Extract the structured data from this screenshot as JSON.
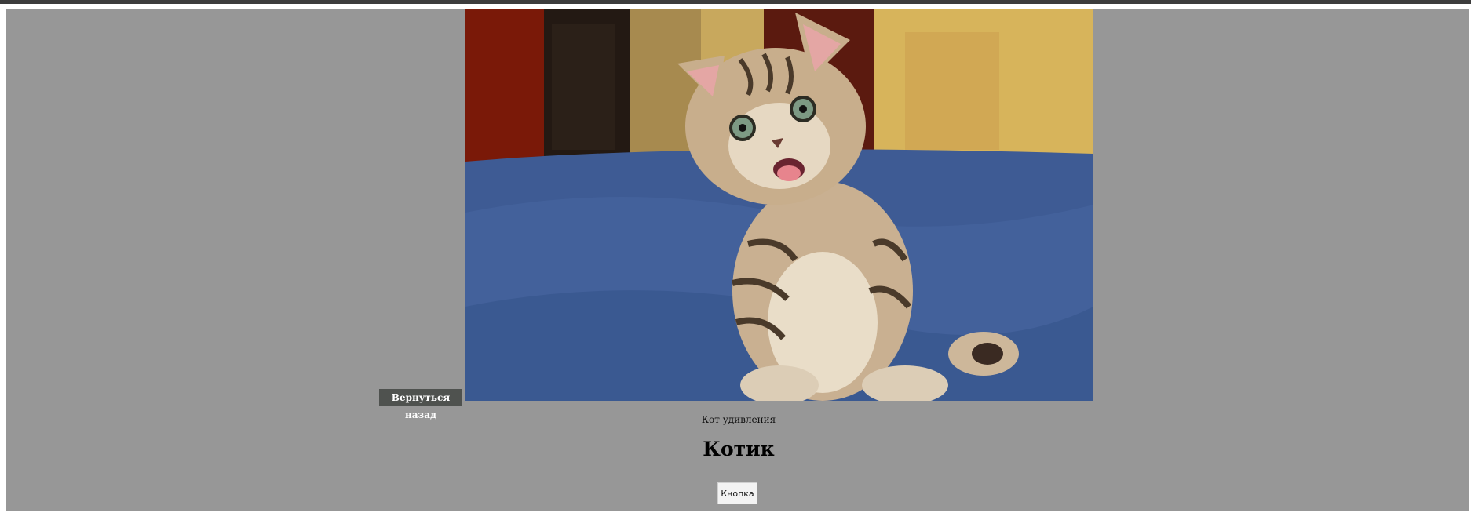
{
  "page": {
    "back_button_label": "Вернуться назад",
    "image_caption": "Кот удивления",
    "title": "Котик",
    "button_label": "Кнопка"
  },
  "image": {
    "alt": "Кот удивления",
    "icon": "kitten-photo"
  },
  "colors": {
    "page_background": "#979797",
    "back_button_background": "#4f524f",
    "back_button_text": "#ffffff"
  }
}
